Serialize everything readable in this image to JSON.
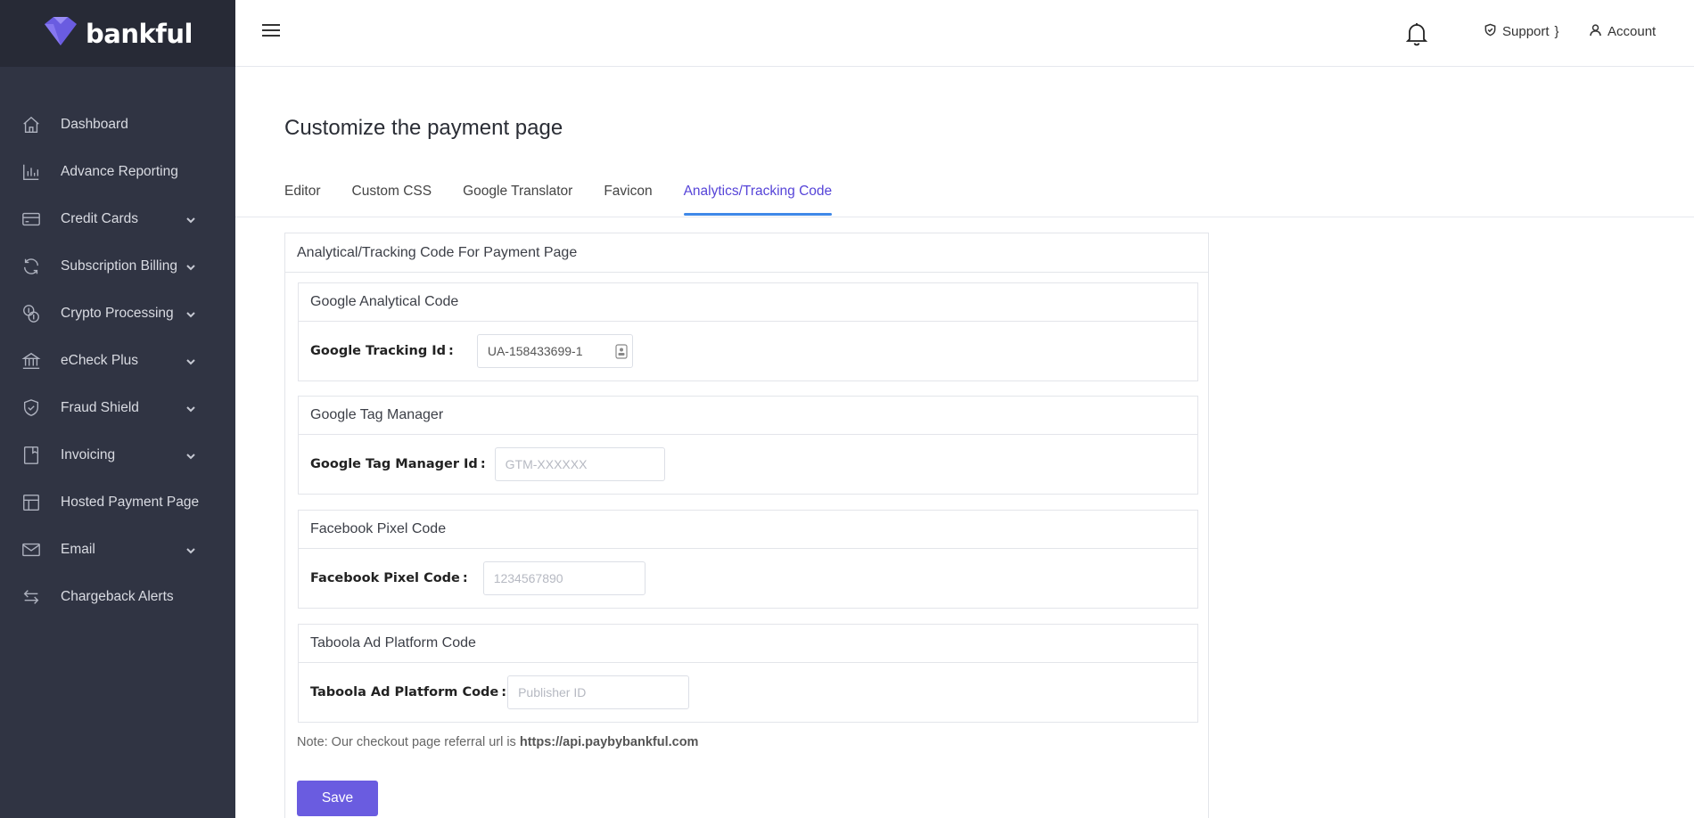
{
  "brand": {
    "name": "bankful",
    "accent": "#6a5ce0"
  },
  "header": {
    "support_label": "Support",
    "account_label": "Account"
  },
  "sidebar": {
    "items": [
      {
        "label": "Dashboard",
        "icon": "home-icon",
        "expandable": false
      },
      {
        "label": "Advance Reporting",
        "icon": "bar-chart-icon",
        "expandable": false
      },
      {
        "label": "Credit Cards",
        "icon": "credit-card-icon",
        "expandable": true
      },
      {
        "label": "Subscription Billing",
        "icon": "refresh-icon",
        "expandable": true
      },
      {
        "label": "Crypto Processing",
        "icon": "coins-icon",
        "expandable": true
      },
      {
        "label": "eCheck Plus",
        "icon": "bank-icon",
        "expandable": true
      },
      {
        "label": "Fraud Shield",
        "icon": "shield-icon",
        "expandable": true
      },
      {
        "label": "Invoicing",
        "icon": "bookmark-icon",
        "expandable": true
      },
      {
        "label": "Hosted Payment Page",
        "icon": "layout-icon",
        "expandable": false
      },
      {
        "label": "Email",
        "icon": "mail-icon",
        "expandable": true
      },
      {
        "label": "Chargeback Alerts",
        "icon": "swap-icon",
        "expandable": false
      }
    ]
  },
  "main": {
    "title": "Customize the payment page",
    "tabs": [
      {
        "label": "Editor",
        "active": false
      },
      {
        "label": "Custom CSS",
        "active": false
      },
      {
        "label": "Google Translator",
        "active": false
      },
      {
        "label": "Favicon",
        "active": false
      },
      {
        "label": "Analytics/Tracking Code",
        "active": true
      }
    ],
    "card_title": "Analytical/Tracking Code For Payment Page",
    "sections": [
      {
        "title": "Google Analytical Code",
        "field_label": "Google Tracking Id",
        "value": "UA-158433699-1",
        "placeholder": ""
      },
      {
        "title": "Google Tag Manager",
        "field_label": "Google Tag Manager Id",
        "value": "",
        "placeholder": "GTM-XXXXXX"
      },
      {
        "title": "Facebook Pixel Code",
        "field_label": "Facebook Pixel Code",
        "value": "",
        "placeholder": "1234567890"
      },
      {
        "title": "Taboola Ad Platform Code",
        "field_label": "Taboola Ad Platform Code",
        "value": "",
        "placeholder": "Publisher ID"
      }
    ],
    "note_prefix": "Note: Our checkout page referral url is",
    "note_url": "https://api.paybybankful.com",
    "save_label": "Save"
  }
}
